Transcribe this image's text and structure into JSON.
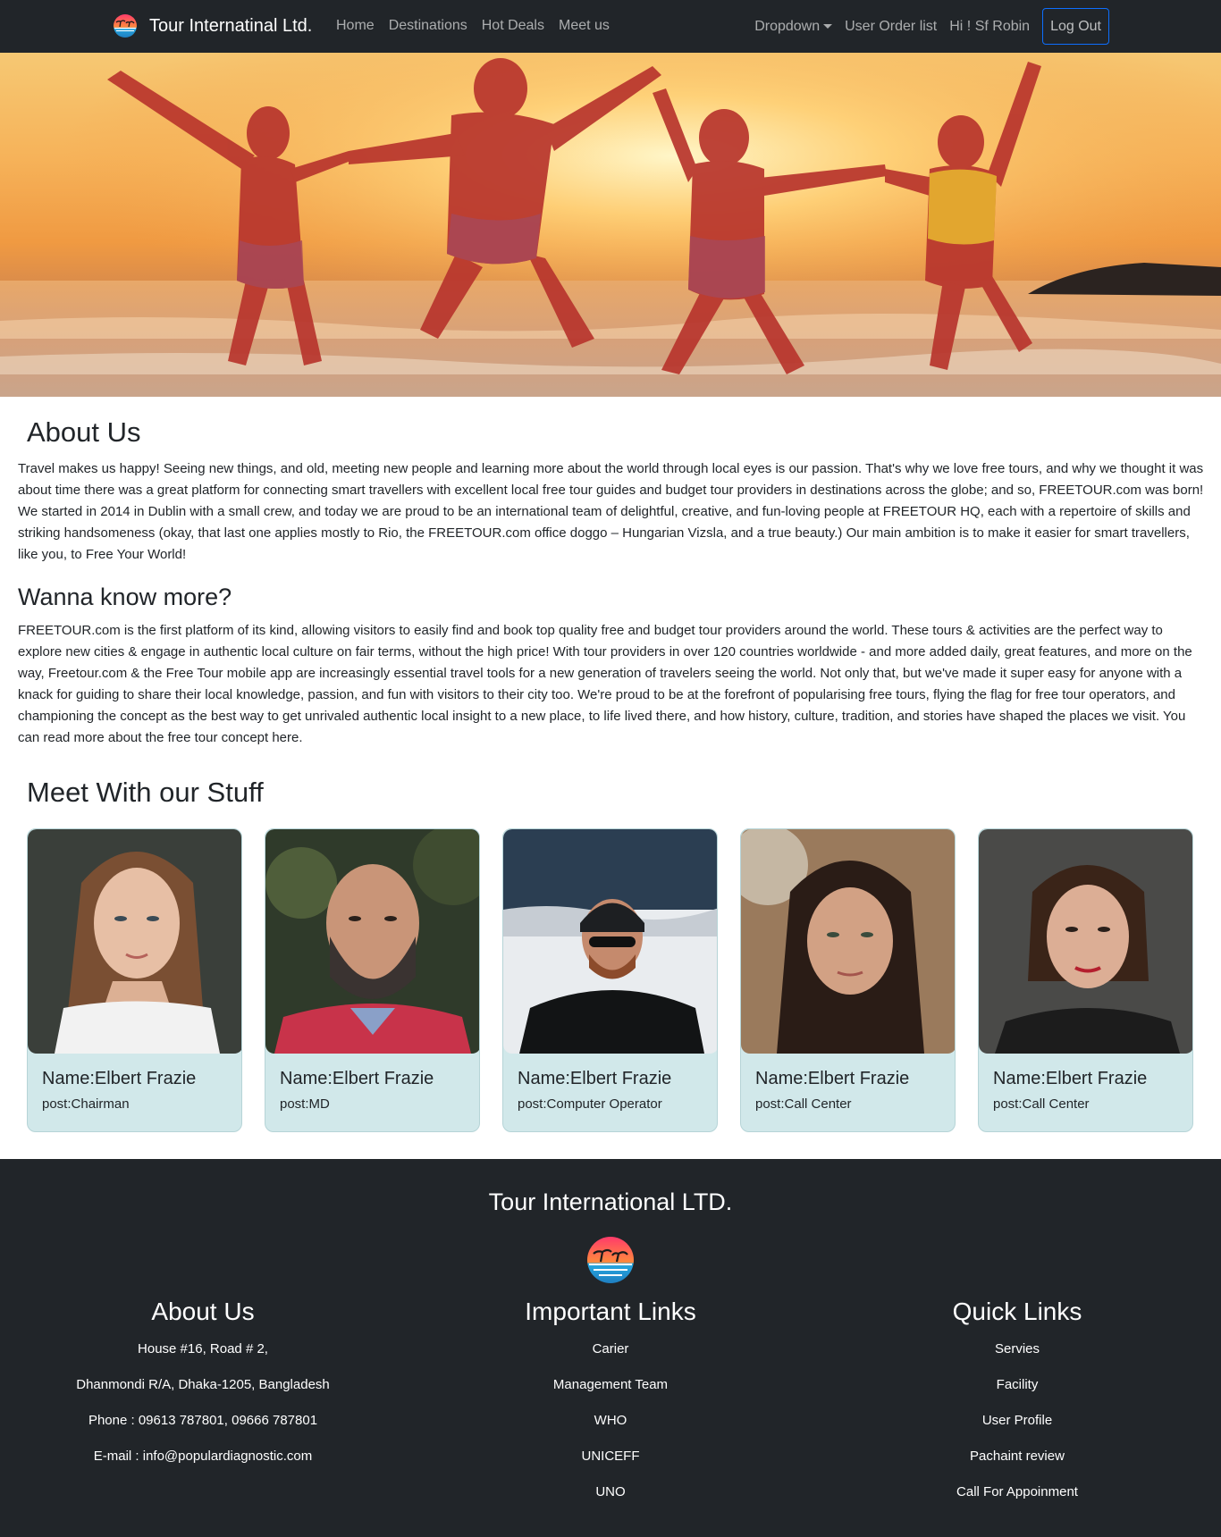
{
  "navbar": {
    "brand": "Tour Internatinal Ltd.",
    "links": [
      "Home",
      "Destinations",
      "Hot Deals",
      "Meet us"
    ],
    "dropdown": "Dropdown",
    "order_list": "User Order list",
    "greeting": "Hi ! Sf Robin",
    "logout": "Log Out"
  },
  "about": {
    "title": "About Us",
    "text": "Travel makes us happy! Seeing new things, and old, meeting new people and learning more about the world through local eyes is our passion. That's why we love free tours, and why we thought it was about time there was a great platform for connecting smart travellers with excellent local free tour guides and budget tour providers in destinations across the globe; and so, FREETOUR.com was born! We started in 2014 in Dublin with a small crew, and today we are proud to be an international team of delightful, creative, and fun-loving people at FREETOUR HQ, each with a repertoire of skills and striking handsomeness (okay, that last one applies mostly to Rio, the FREETOUR.com office doggo – Hungarian Vizsla, and a true beauty.) Our main ambition is to make it easier for smart travellers, like you, to Free Your World!"
  },
  "more": {
    "title": "Wanna know more?",
    "text": "FREETOUR.com is the first platform of its kind, allowing visitors to easily find and book top quality free and budget tour providers around the world. These tours & activities are the perfect way to explore new cities & engage in authentic local culture on fair terms, without the high price! With tour providers in over 120 countries worldwide - and more added daily, great features, and more on the way, Freetour.com & the Free Tour mobile app are increasingly essential travel tools for a new generation of travelers seeing the world. Not only that, but we've made it super easy for anyone with a knack for guiding to share their local knowledge, passion, and fun with visitors to their city too. We're proud to be at the forefront of popularising free tours, flying the flag for free tour operators, and championing the concept as the best way to get unrivaled authentic local insight to a new place, to life lived there, and how history, culture, tradition, and stories have shaped the places we visit. You can read more about the free tour concept here."
  },
  "staff": {
    "title": "Meet With our Stuff",
    "members": [
      {
        "name": "Name:Elbert Frazie",
        "post": "post:Chairman"
      },
      {
        "name": "Name:Elbert Frazie",
        "post": "post:MD"
      },
      {
        "name": "Name:Elbert Frazie",
        "post": "post:Computer Operator"
      },
      {
        "name": "Name:Elbert Frazie",
        "post": "post:Call Center"
      },
      {
        "name": "Name:Elbert Frazie",
        "post": "post:Call Center"
      }
    ]
  },
  "footer": {
    "title": "Tour International LTD.",
    "about": {
      "title": "About Us",
      "lines": [
        "House #16, Road # 2,",
        "Dhanmondi R/A, Dhaka-1205, Bangladesh",
        "Phone : 09613 787801, 09666 787801",
        "E-mail : info@populardiagnostic.com"
      ]
    },
    "important": {
      "title": "Important Links",
      "links": [
        "Carier",
        "Management Team",
        "WHO",
        "UNICEFF",
        "UNO"
      ]
    },
    "quick": {
      "title": "Quick Links",
      "links": [
        "Servies",
        "Facility",
        "User Profile",
        "Pachaint review",
        "Call For Appoinment"
      ]
    }
  },
  "colors": {
    "navbar_bg": "#212529",
    "card_bg": "#d1e8ea",
    "logout_border": "#0d6efd"
  }
}
